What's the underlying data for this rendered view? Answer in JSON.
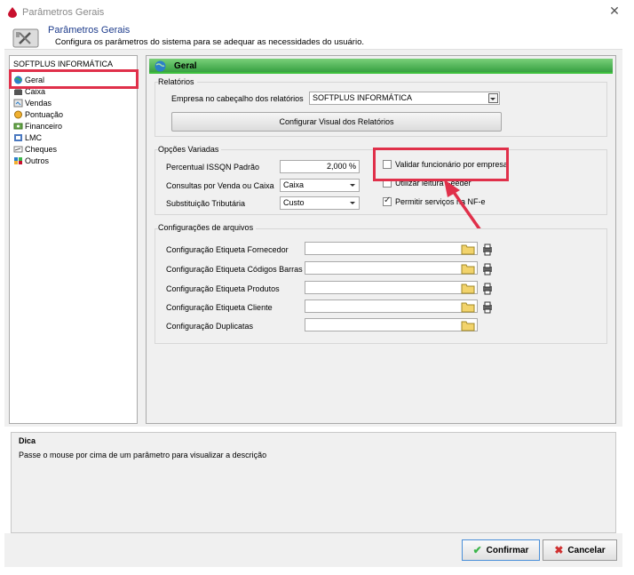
{
  "window": {
    "title": "Parâmetros Gerais",
    "close_label": "✕"
  },
  "header": {
    "title": "Parâmetros Gerais",
    "subtitle": "Configura os parâmetros do sistema para se adequar as necessidades do usuário."
  },
  "sidebar": {
    "company": "SOFTPLUS INFORMÁTICA",
    "items": [
      {
        "label": "Geral",
        "icon": "globe-icon"
      },
      {
        "label": "Caixa",
        "icon": "cash-register-icon"
      },
      {
        "label": "Vendas",
        "icon": "sales-icon"
      },
      {
        "label": "Pontuação",
        "icon": "points-icon"
      },
      {
        "label": "Financeiro",
        "icon": "finance-icon"
      },
      {
        "label": "LMC",
        "icon": "lmc-icon"
      },
      {
        "label": "Cheques",
        "icon": "cheque-icon"
      },
      {
        "label": "Outros",
        "icon": "others-icon"
      }
    ]
  },
  "main": {
    "section_title": "Geral",
    "relatorios": {
      "group_label": "Relatórios",
      "empresa_label": "Empresa no cabeçalho dos relatórios",
      "empresa_value": "SOFTPLUS INFORMÁTICA",
      "config_button": "Configurar Visual dos Relatórios"
    },
    "opcoes": {
      "group_label": "Opções Variadas",
      "issqn_label": "Percentual ISSQN Padrão",
      "issqn_value": "2,000 %",
      "consultas_label": "Consultas por Venda ou Caixa",
      "consultas_value": "Caixa",
      "st_label": "Substituição Tributária",
      "st_value": "Custo",
      "chk_validar": "Validar funcionário por empresa",
      "chk_validar_checked": false,
      "chk_feeder": "Utilizar leitura Feeder",
      "chk_feeder_checked": false,
      "chk_servicos": "Permitir serviços na NF-e",
      "chk_servicos_checked": true
    },
    "arquivos": {
      "group_label": "Configurações de arquivos",
      "rows": [
        {
          "label": "Configuração Etiqueta Fornecedor",
          "value": "",
          "has_print": true
        },
        {
          "label": "Configuração Etiqueta Códigos Barras",
          "value": "",
          "has_print": true
        },
        {
          "label": "Configuração Etiqueta Produtos",
          "value": "",
          "has_print": true
        },
        {
          "label": "Configuração Etiqueta Cliente",
          "value": "",
          "has_print": true
        },
        {
          "label": "Configuração Duplicatas",
          "value": "",
          "has_print": false
        }
      ]
    }
  },
  "dica": {
    "title": "Dica",
    "text": "Passe o mouse por cima de um parâmetro para visualizar a descrição"
  },
  "footer": {
    "confirm_label": "Confirmar",
    "cancel_label": "Cancelar"
  },
  "colors": {
    "highlight": "#e0304a",
    "header_title": "#1e3c8c",
    "section_bar": "#2e9a3a"
  }
}
